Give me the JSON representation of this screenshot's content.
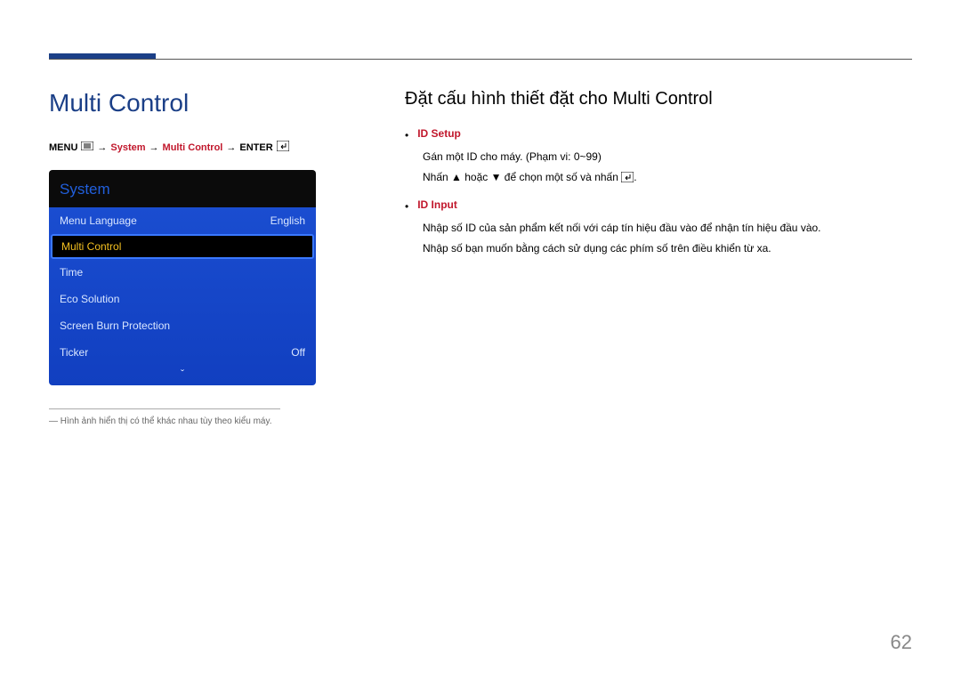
{
  "page": {
    "section_title": "Multi Control",
    "page_number": "62"
  },
  "breadcrumb": {
    "menu_label": "MENU",
    "system": "System",
    "multi_control": "Multi Control",
    "enter_label": "ENTER"
  },
  "osd": {
    "title": "System",
    "rows": [
      {
        "label": "Menu Language",
        "value": "English"
      },
      {
        "label": "Multi Control",
        "value": ""
      },
      {
        "label": "Time",
        "value": ""
      },
      {
        "label": "Eco Solution",
        "value": ""
      },
      {
        "label": "Screen Burn Protection",
        "value": ""
      },
      {
        "label": "Ticker",
        "value": "Off"
      }
    ],
    "scroll_glyph": "ˇ"
  },
  "footnote": "Hình ảnh hiển thị có thể khác nhau tùy theo kiểu máy.",
  "right": {
    "heading": "Đặt cấu hình thiết đặt cho Multi Control",
    "items": [
      {
        "title": "ID Setup",
        "lines": [
          "Gán một ID cho máy. (Phạm vi: 0~99)",
          "Nhấn ▲ hoặc ▼ để chọn một số và nhấn "
        ]
      },
      {
        "title": "ID Input",
        "lines": [
          "Nhập số ID của sản phẩm kết nối với cáp tín hiệu đầu vào để nhận tín hiệu đầu vào.",
          "Nhập số bạn muốn bằng cách sử dụng các phím số trên điều khiển từ xa."
        ]
      }
    ]
  }
}
